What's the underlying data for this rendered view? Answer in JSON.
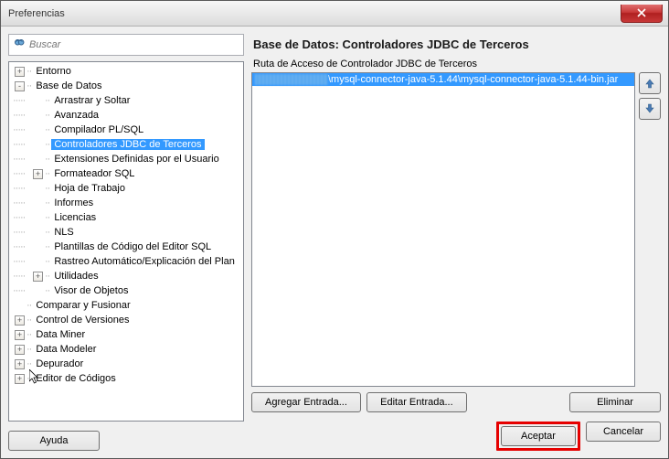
{
  "window": {
    "title": "Preferencias"
  },
  "search": {
    "placeholder": "Buscar"
  },
  "tree": {
    "items": [
      {
        "indent": 0,
        "toggle": "+",
        "label": "Entorno"
      },
      {
        "indent": 0,
        "toggle": "-",
        "label": "Base de Datos"
      },
      {
        "indent": 1,
        "toggle": "",
        "label": "Arrastrar y Soltar"
      },
      {
        "indent": 1,
        "toggle": "",
        "label": "Avanzada"
      },
      {
        "indent": 1,
        "toggle": "",
        "label": "Compilador PL/SQL"
      },
      {
        "indent": 1,
        "toggle": "",
        "label": "Controladores JDBC de Terceros",
        "selected": true
      },
      {
        "indent": 1,
        "toggle": "",
        "label": "Extensiones Definidas por el Usuario"
      },
      {
        "indent": 1,
        "toggle": "+",
        "label": "Formateador SQL"
      },
      {
        "indent": 1,
        "toggle": "",
        "label": "Hoja de Trabajo"
      },
      {
        "indent": 1,
        "toggle": "",
        "label": "Informes"
      },
      {
        "indent": 1,
        "toggle": "",
        "label": "Licencias"
      },
      {
        "indent": 1,
        "toggle": "",
        "label": "NLS"
      },
      {
        "indent": 1,
        "toggle": "",
        "label": "Plantillas de Código del Editor SQL"
      },
      {
        "indent": 1,
        "toggle": "",
        "label": "Rastreo Automático/Explicación del Plan"
      },
      {
        "indent": 1,
        "toggle": "+",
        "label": "Utilidades"
      },
      {
        "indent": 1,
        "toggle": "",
        "label": "Visor de Objetos"
      },
      {
        "indent": 0,
        "toggle": "",
        "label": "Comparar y Fusionar"
      },
      {
        "indent": 0,
        "toggle": "+",
        "label": "Control de Versiones"
      },
      {
        "indent": 0,
        "toggle": "+",
        "label": "Data Miner"
      },
      {
        "indent": 0,
        "toggle": "+",
        "label": "Data Modeler"
      },
      {
        "indent": 0,
        "toggle": "+",
        "label": "Depurador"
      },
      {
        "indent": 0,
        "toggle": "+",
        "label": "Editor de Códigos"
      }
    ]
  },
  "panel": {
    "title": "Base de Datos: Controladores JDBC de Terceros",
    "section_label": "Ruta de Acceso de Controlador JDBC de Terceros",
    "path_visible": "\\mysql-connector-java-5.1.44\\mysql-connector-java-5.1.44-bin.jar"
  },
  "buttons": {
    "help": "Ayuda",
    "add": "Agregar Entrada...",
    "edit": "Editar Entrada...",
    "delete": "Eliminar",
    "ok": "Aceptar",
    "cancel": "Cancelar"
  }
}
